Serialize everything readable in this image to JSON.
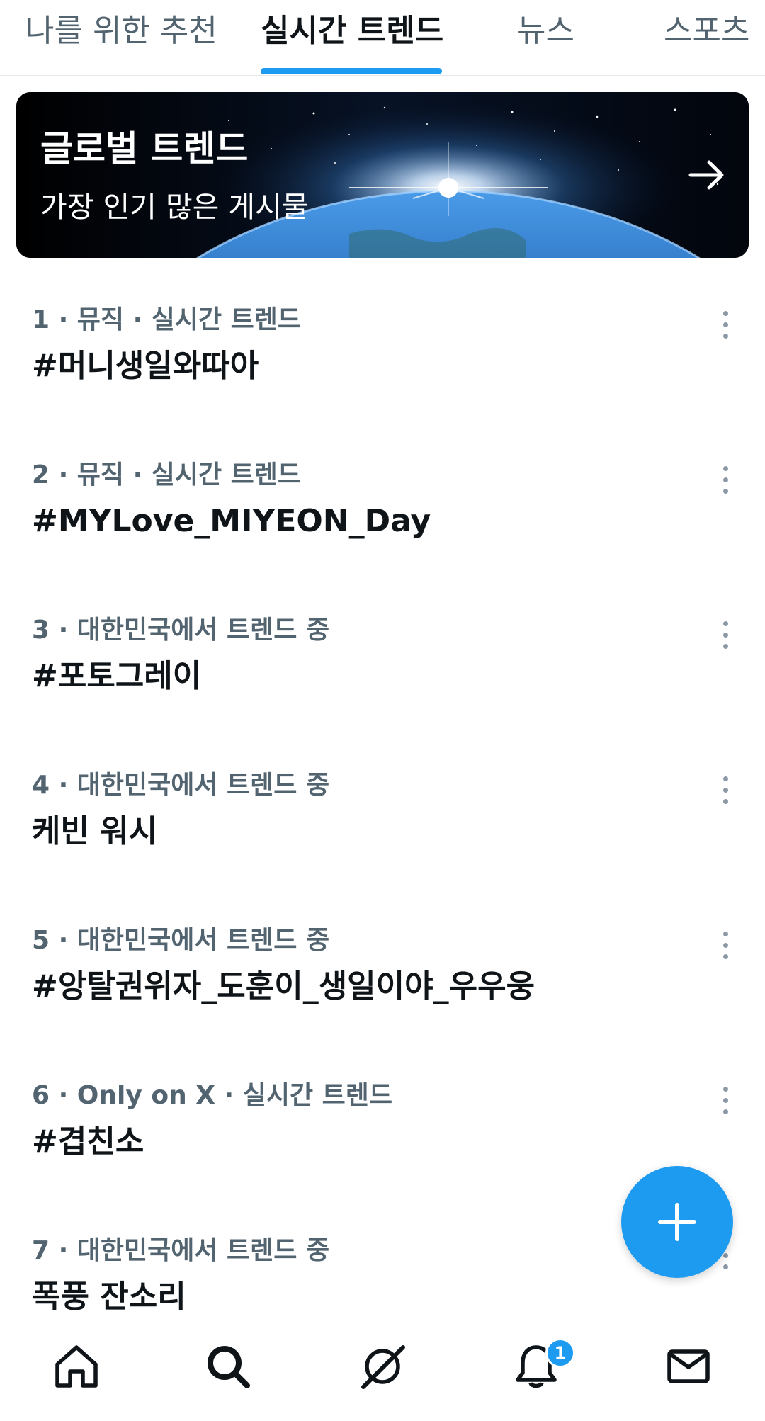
{
  "tabs": [
    {
      "label": "나를 위한 추천",
      "active": false
    },
    {
      "label": "실시간 트렌드",
      "active": true
    },
    {
      "label": "뉴스",
      "active": false
    },
    {
      "label": "스포츠",
      "active": false
    }
  ],
  "banner": {
    "title": "글로벌 트렌드",
    "subtitle": "가장 인기 많은 게시물",
    "arrow_icon": "arrow-right-icon"
  },
  "trends": [
    {
      "meta": "1 · 뮤직 · 실시간 트렌드",
      "title": "#머니생일와따아"
    },
    {
      "meta": "2 · 뮤직 · 실시간 트렌드",
      "title": "#MYLove_MIYEON_Day"
    },
    {
      "meta": "3 · 대한민국에서 트렌드 중",
      "title": "#포토그레이"
    },
    {
      "meta": "4 · 대한민국에서 트렌드 중",
      "title": "케빈 워시"
    },
    {
      "meta": "5 · 대한민국에서 트렌드 중",
      "title": "#앙탈권위자_도훈이_생일이야_우우웅"
    },
    {
      "meta": "6 · Only on X · 실시간 트렌드",
      "title": "#겹친소"
    },
    {
      "meta": "7 · 대한민국에서 트렌드 중",
      "title": "폭풍 잔소리"
    }
  ],
  "fab": {
    "icon": "plus-icon"
  },
  "bottom_nav": {
    "items": [
      "home-icon",
      "search-icon",
      "grok-icon",
      "notifications-icon",
      "messages-icon"
    ],
    "notification_badge": "1"
  },
  "colors": {
    "accent": "#1d9bf0",
    "text_primary": "#0f1419",
    "text_secondary": "#536471",
    "divider": "#e6e9ec"
  }
}
